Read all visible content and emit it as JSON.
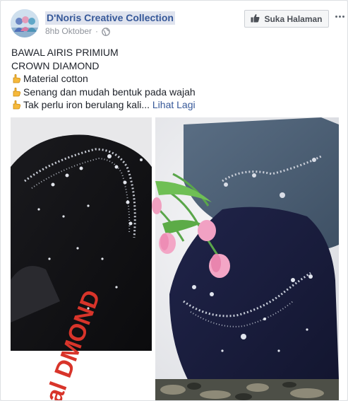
{
  "post": {
    "page_name": "D'Noris Creative Collection",
    "timestamp": "8hb Oktober",
    "privacy_icon": "globe-icon",
    "like_page_label": "Suka Halaman",
    "text": {
      "line1": "BAWAL AIRIS PRIMIUM",
      "line2": "CROWN DIAMOND",
      "bullet1": "Material cotton",
      "bullet2": "Senang dan mudah bentuk pada wajah",
      "bullet3": "Tak perlu iron berulang kali",
      "ellipsis": "...",
      "see_more": "Lihat Lagi"
    },
    "image": {
      "overlay_text": "al   DMOND"
    }
  },
  "colors": {
    "link": "#365899",
    "meta": "#90949c",
    "text": "#1d2129",
    "hijab_navy": "#1b1f3d",
    "hijab_grey": "#4e6378",
    "overlay_red": "#d8342a"
  }
}
